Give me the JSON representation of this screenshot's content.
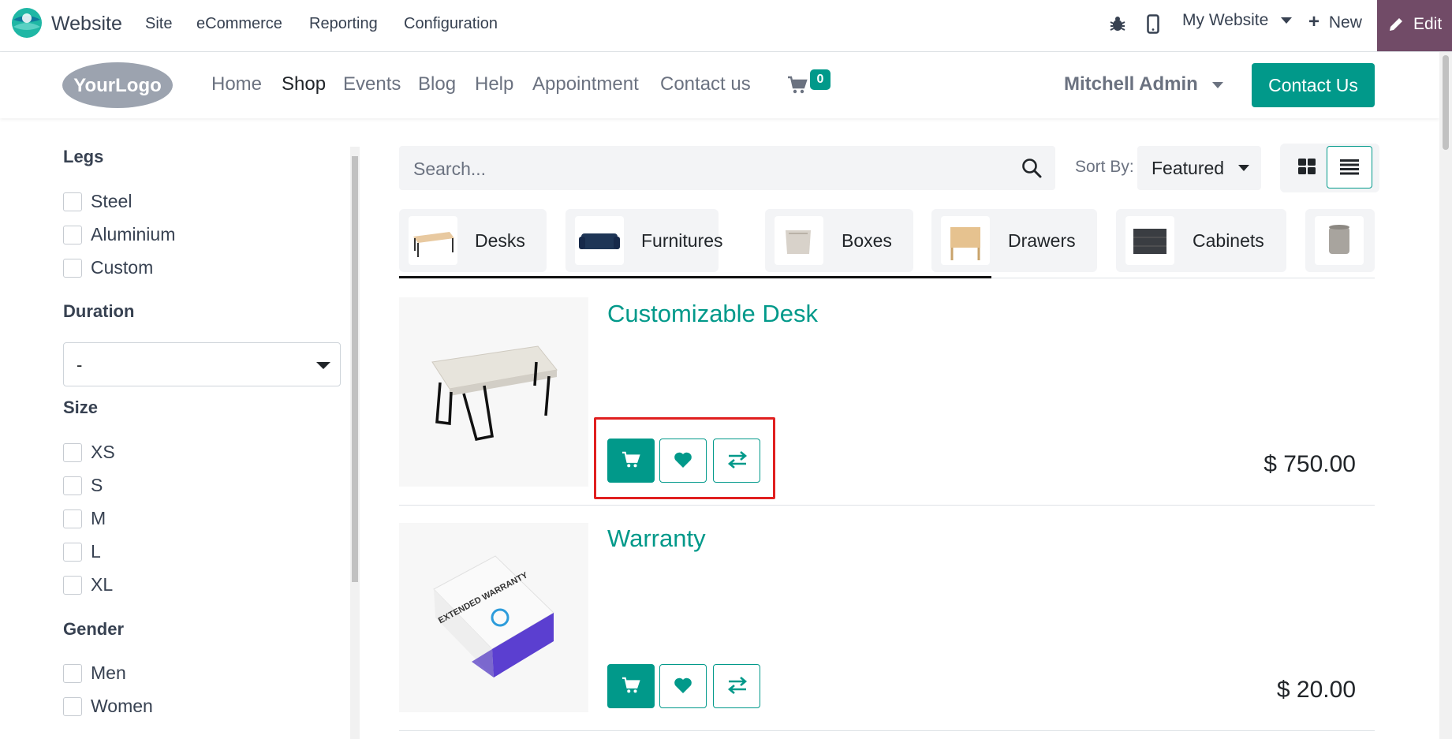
{
  "topbar": {
    "app_name": "Website",
    "menus": [
      "Site",
      "eCommerce",
      "Reporting",
      "Configuration"
    ],
    "website_selector": "My Website",
    "new_label": "New",
    "edit_label": "Edit",
    "edit_color": "#714B67"
  },
  "header": {
    "logo_text": "YourLogo",
    "nav": [
      "Home",
      "Shop",
      "Events",
      "Blog",
      "Help",
      "Appointment",
      "Contact us"
    ],
    "active_nav": "Shop",
    "cart_count": "0",
    "user_name": "Mitchell Admin",
    "contact_button": "Contact Us",
    "accent_color": "#01998a"
  },
  "sidebar": {
    "legs": {
      "title": "Legs",
      "options": [
        "Steel",
        "Aluminium",
        "Custom"
      ]
    },
    "duration": {
      "title": "Duration",
      "selected": "-"
    },
    "size": {
      "title": "Size",
      "options": [
        "XS",
        "S",
        "M",
        "L",
        "XL"
      ]
    },
    "gender": {
      "title": "Gender",
      "options": [
        "Men",
        "Women"
      ]
    }
  },
  "toolbar": {
    "search_placeholder": "Search...",
    "sort_label": "Sort By:",
    "sort_value": "Featured",
    "active_view": "list"
  },
  "categories": [
    "Desks",
    "Furnitures",
    "Boxes",
    "Drawers",
    "Cabinets"
  ],
  "products": [
    {
      "name": "Customizable Desk",
      "price": "$ 750.00"
    },
    {
      "name": "Warranty",
      "price": "$ 20.00",
      "box_text": "EXTENDED WARRANTY"
    }
  ]
}
